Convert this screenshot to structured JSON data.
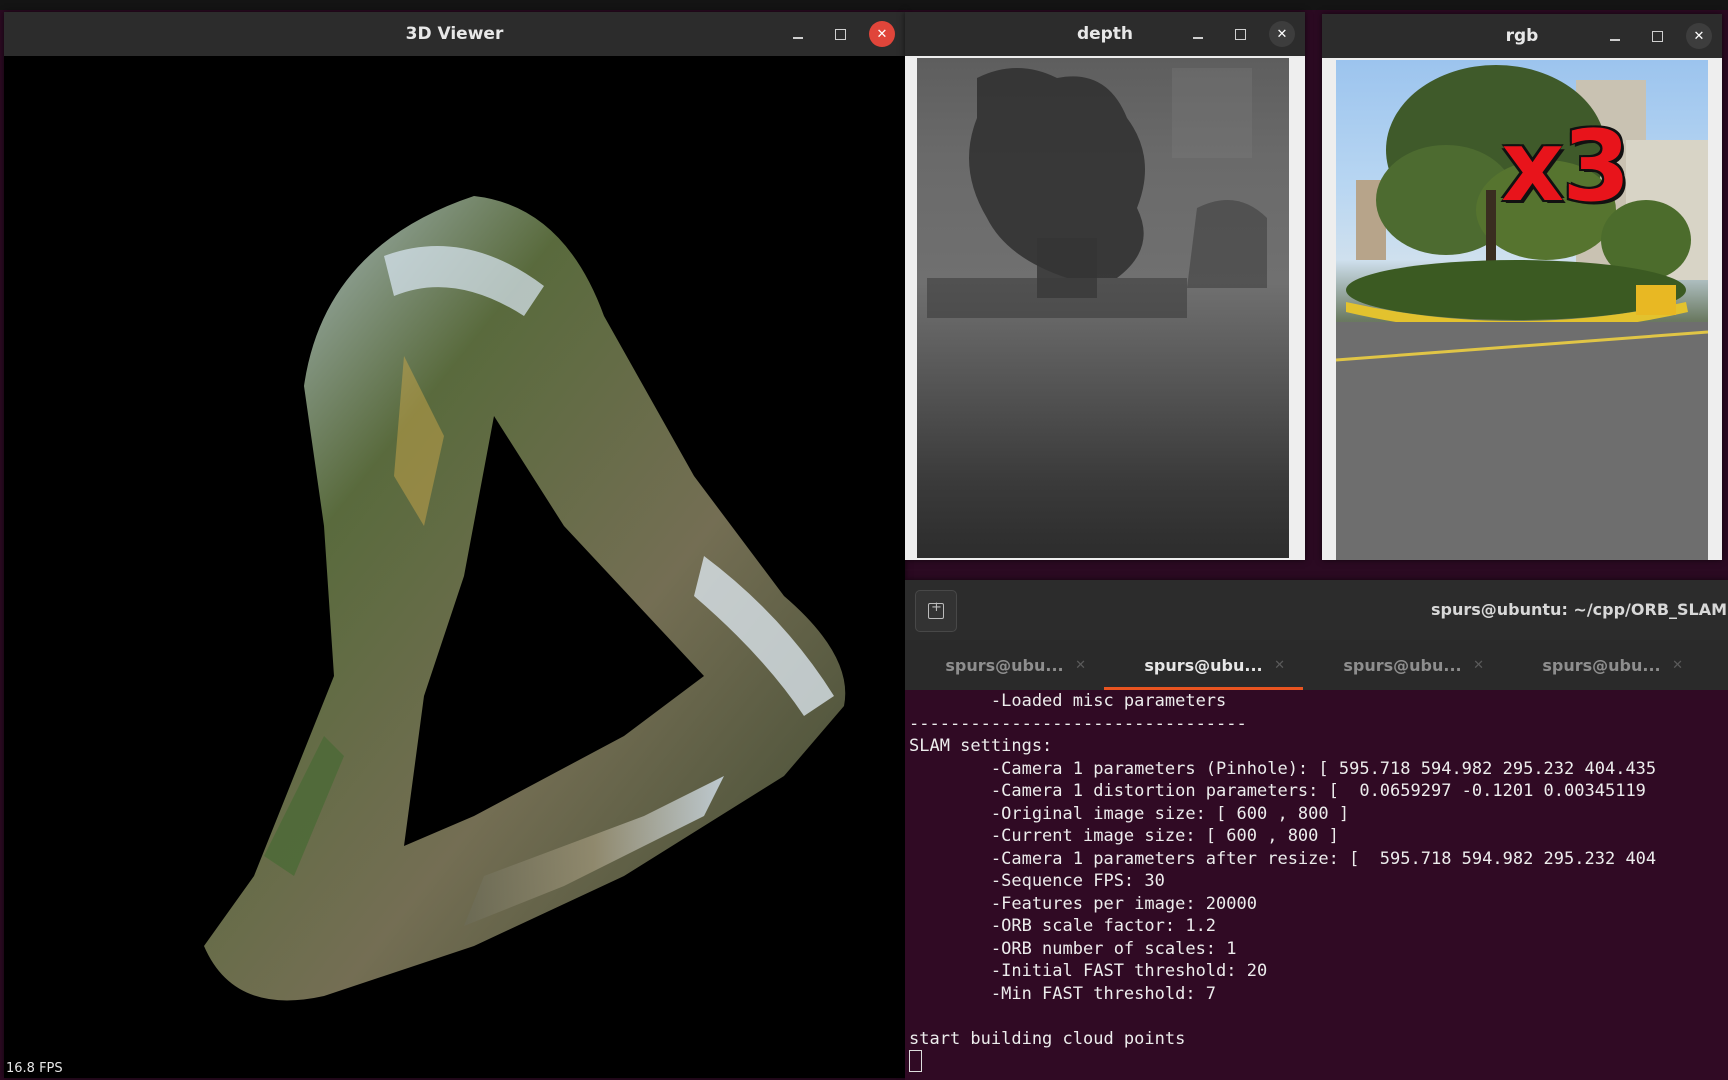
{
  "viewer": {
    "title": "3D Viewer",
    "fps_label": "16.8 FPS"
  },
  "depth_window": {
    "title": "depth"
  },
  "rgb_window": {
    "title": "rgb",
    "overlay_text": "x3"
  },
  "terminal": {
    "title": "spurs@ubuntu: ~/cpp/ORB_SLAM",
    "tabs": [
      {
        "label": "spurs@ubu..."
      },
      {
        "label": "spurs@ubu..."
      },
      {
        "label": "spurs@ubu..."
      },
      {
        "label": "spurs@ubu..."
      }
    ],
    "lines": [
      "        -Loaded misc parameters",
      "---------------------------------",
      "SLAM settings:",
      "        -Camera 1 parameters (Pinhole): [ 595.718 594.982 295.232 404.435",
      "        -Camera 1 distortion parameters: [  0.0659297 -0.1201 0.00345119",
      "        -Original image size: [ 600 , 800 ]",
      "        -Current image size: [ 600 , 800 ]",
      "        -Camera 1 parameters after resize: [  595.718 594.982 295.232 404",
      "        -Sequence FPS: 30",
      "        -Features per image: 20000",
      "        -ORB scale factor: 1.2",
      "        -ORB number of scales: 1",
      "        -Initial FAST threshold: 20",
      "        -Min FAST threshold: 7",
      "",
      "start building cloud points"
    ]
  },
  "colors": {
    "terminal_bg": "#300a24",
    "tab_accent": "#e95420",
    "close_red": "#e0453a"
  }
}
